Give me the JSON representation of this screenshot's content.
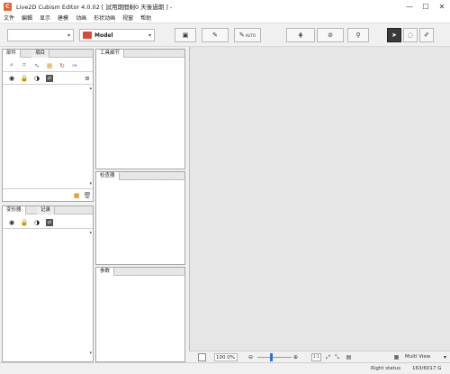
{
  "window": {
    "title": "Live2D Cubism Editor 4.0.02  [ 試用期間剩0 天後過期 ] -",
    "app_icon_letter": "C",
    "controls": {
      "minimize": "—",
      "maximize": "☐",
      "close": "✕"
    }
  },
  "menu": [
    "文件",
    "編輯",
    "显示",
    "建模",
    "动画",
    "形状动画",
    "视窗",
    "帮助"
  ],
  "toolbar": {
    "model_combo": "Model",
    "auto_label": "AUTO"
  },
  "panels": {
    "parts": {
      "tabs": [
        "部件",
        "項目"
      ]
    },
    "tool_detail": {
      "title": "工具細节"
    },
    "deformer": {
      "tabs": [
        "变形器",
        "记录"
      ]
    },
    "inspector": {
      "title": "检查器"
    },
    "params": {
      "title": "参数"
    }
  },
  "bottombar": {
    "zoom": "100.0",
    "zoom_unit": "%",
    "ratio_label": "1:1",
    "view_label": "Multi View"
  },
  "status": {
    "right_status": "Right status",
    "memory": "163/6017 G"
  },
  "colors": {
    "accent_orange": "#e8632b",
    "model_red": "#d94a3a",
    "canvas_bg": "#e6e6e6",
    "slider_blue": "#2a6fdb"
  }
}
